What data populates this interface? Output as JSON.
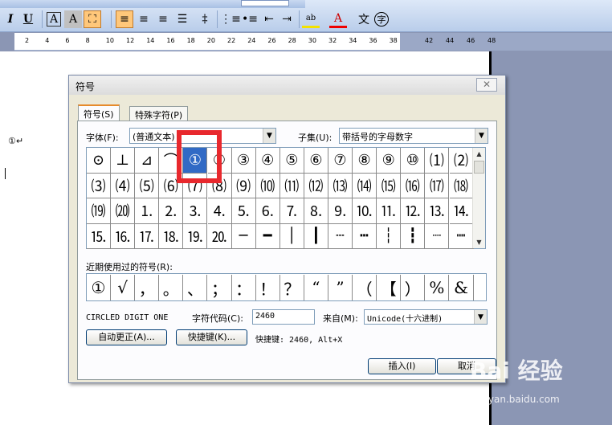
{
  "toolbar": {
    "buttons": [
      {
        "name": "italic-button",
        "label": "I"
      },
      {
        "name": "underline-button",
        "label": "U"
      },
      {
        "name": "char-border-button",
        "label": "A"
      },
      {
        "name": "char-shading-button",
        "label": "A"
      },
      {
        "name": "align-left-button",
        "label": "≡"
      },
      {
        "name": "align-center-button",
        "label": "≡"
      },
      {
        "name": "align-right-button",
        "label": "≡"
      },
      {
        "name": "line-spacing-button",
        "label": "‡"
      },
      {
        "name": "numbering-button",
        "label": "⋮≡"
      },
      {
        "name": "bullets-button",
        "label": "•≡"
      },
      {
        "name": "decrease-indent-button",
        "label": "⇤"
      },
      {
        "name": "increase-indent-button",
        "label": "⇥"
      },
      {
        "name": "highlight-button",
        "label": "ab"
      },
      {
        "name": "font-color-button",
        "label": "A"
      },
      {
        "name": "phonetic-guide-button",
        "label": "文"
      },
      {
        "name": "enclose-char-button",
        "label": "字"
      }
    ]
  },
  "ruler": {
    "left_ticks": [
      "2",
      "4",
      "6",
      "8",
      "10",
      "12",
      "14",
      "16",
      "18",
      "20",
      "22",
      "24",
      "26",
      "28",
      "30",
      "32",
      "34",
      "36",
      "38"
    ],
    "right_ticks": [
      "42",
      "44",
      "46",
      "48"
    ]
  },
  "document": {
    "paragraph": "①↵"
  },
  "dialog": {
    "title": "符号",
    "close": "✕",
    "tabs": {
      "symbols": "符号(S)",
      "special": "特殊字符(P)"
    },
    "font_label": "字体(F):",
    "font_value": "(普通文本)",
    "subset_label": "子集(U):",
    "subset_value": "带括号的字母数字",
    "grid_rows": [
      [
        "⊙",
        "⊥",
        "⊿",
        "⌒",
        "①",
        "②",
        "③",
        "④",
        "⑤",
        "⑥",
        "⑦",
        "⑧",
        "⑨",
        "⑩",
        "⑴",
        "⑵"
      ],
      [
        "⑶",
        "⑷",
        "⑸",
        "⑹",
        "⑺",
        "⑻",
        "⑼",
        "⑽",
        "⑾",
        "⑿",
        "⒀",
        "⒁",
        "⒂",
        "⒃",
        "⒄",
        "⒅"
      ],
      [
        "⒆",
        "⒇",
        "⒈",
        "⒉",
        "⒊",
        "⒋",
        "⒌",
        "⒍",
        "⒎",
        "⒏",
        "⒐",
        "⒑",
        "⒒",
        "⒓",
        "⒔",
        "⒕"
      ],
      [
        "⒖",
        "⒗",
        "⒘",
        "⒙",
        "⒚",
        "⒛",
        "─",
        "━",
        "│",
        "┃",
        "┄",
        "┅",
        "┆",
        "┇",
        "┈",
        "┉"
      ]
    ],
    "recent_label": "近期使用过的符号(R):",
    "recent": [
      "①",
      "√",
      "，",
      "。",
      "、",
      "；",
      "：",
      "！",
      "？",
      "“",
      "”",
      "（",
      "【",
      "）",
      "%",
      "&"
    ],
    "char_name": "CIRCLED DIGIT ONE",
    "code_label": "字符代码(C):",
    "code_value": "2460",
    "from_label": "来自(M):",
    "from_value": "Unicode(十六进制)",
    "autocorrect_button": "自动更正(A)...",
    "shortcut_button": "快捷键(K)...",
    "shortcut_text": "快捷键: 2460, Alt+X",
    "insert_button": "插入(I)",
    "cancel_button": "取消"
  },
  "watermark": {
    "brand": "Bai 经验",
    "url": "jingyan.baidu.com"
  }
}
